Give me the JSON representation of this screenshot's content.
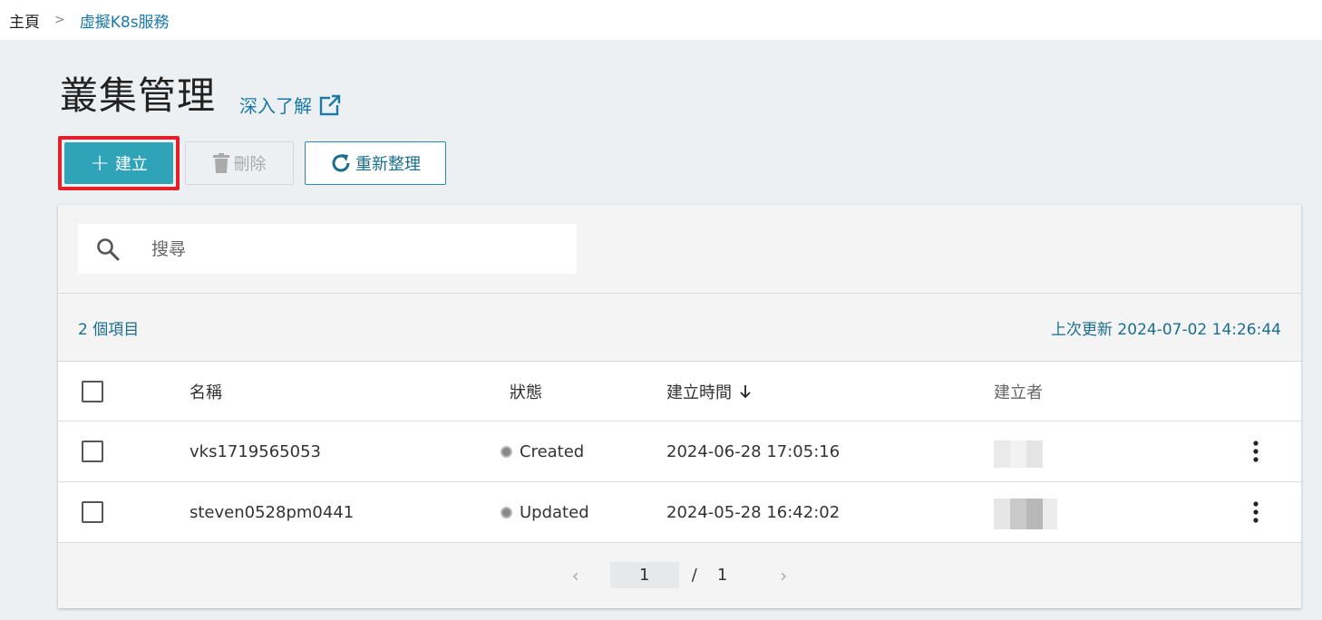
{
  "breadcrumb": {
    "home": "主頁",
    "separator": ">",
    "current": "虛擬K8s服務"
  },
  "page": {
    "title": "叢集管理",
    "learn_more": "深入了解"
  },
  "toolbar": {
    "create": "建立",
    "delete": "刪除",
    "refresh": "重新整理"
  },
  "search": {
    "placeholder": "搜尋"
  },
  "summary": {
    "count": "2 個項目",
    "last_updated": "上次更新 2024-07-02 14:26:44"
  },
  "table": {
    "headers": {
      "name": "名稱",
      "status": "狀態",
      "created_time": "建立時間",
      "creator": "建立者"
    },
    "rows": [
      {
        "name": "vks1719565053",
        "status": "Created",
        "created_time": "2024-06-28 17:05:16"
      },
      {
        "name": "steven0528pm0441",
        "status": "Updated",
        "created_time": "2024-05-28 16:42:02"
      }
    ]
  },
  "pagination": {
    "current": "1",
    "separator": "/",
    "total": "1",
    "prev": "‹",
    "next": "›"
  },
  "colors": {
    "accent": "#2fa4b9",
    "link": "#1a7aa6",
    "highlight": "#e5202b"
  }
}
